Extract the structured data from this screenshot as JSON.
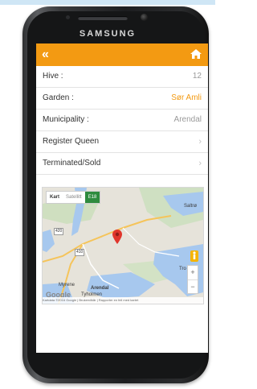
{
  "device": {
    "brand": "SAMSUNG"
  },
  "appbar": {
    "back_icon": "double-chevron-left-icon",
    "home_icon": "home-icon",
    "color": "#f39a12"
  },
  "rows": [
    {
      "label": "Hive :",
      "value": "12"
    },
    {
      "label": "Garden :",
      "value": "Sør Amli"
    },
    {
      "label": "Municipality :",
      "value": "Arendal"
    },
    {
      "label": "Register Queen"
    },
    {
      "label": "Terminated/Sold"
    }
  ],
  "map": {
    "toggle": {
      "map": "Kart",
      "satellite": "Satellitt",
      "road": "E18"
    },
    "labels": {
      "saltrod": "Saltrø",
      "tro": "Tro",
      "myrene": "Myrene",
      "arendal": "Arendal",
      "tyholmen": "Tyholmen"
    },
    "roads": [
      "420",
      "410"
    ],
    "google": "Google",
    "attribution": "Kartdata ©2016 Google  |  Brukervilkår  |  Rapporter en feil med kartet",
    "zoom_in": "+",
    "zoom_out": "−"
  }
}
